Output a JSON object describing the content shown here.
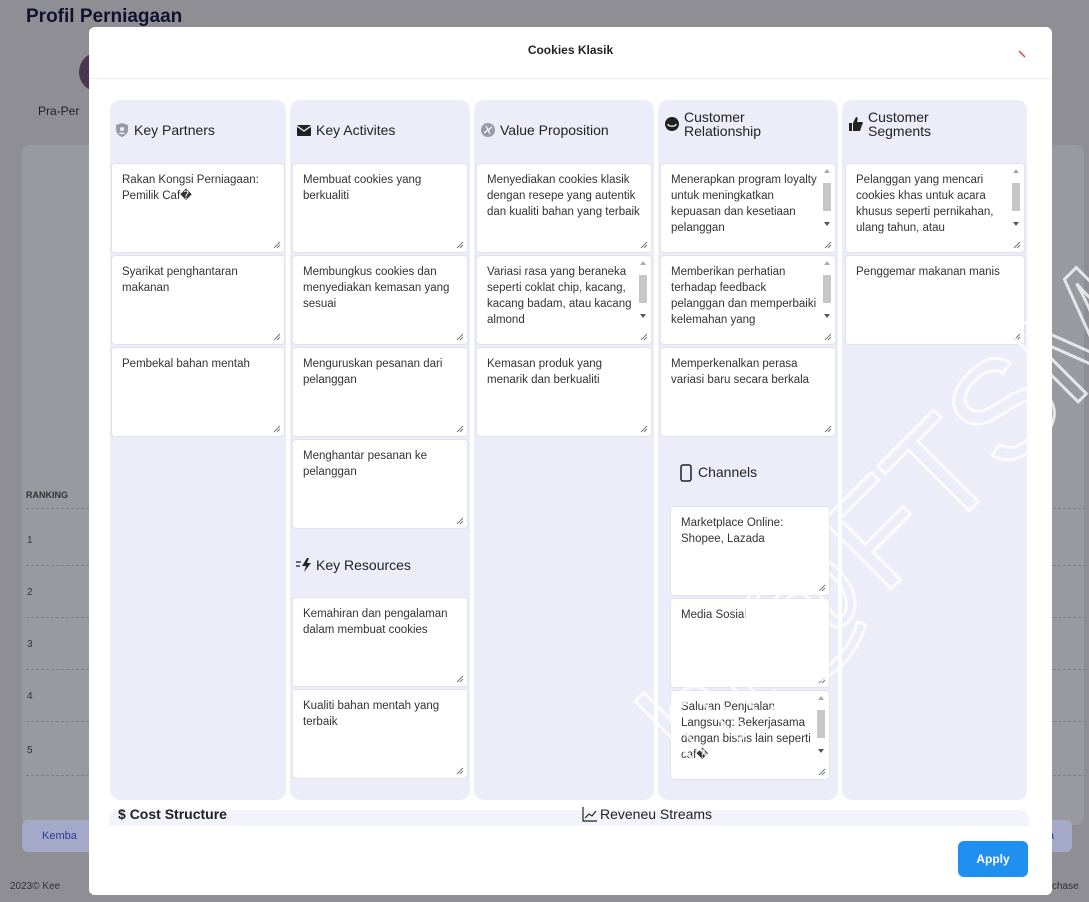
{
  "background": {
    "page_title": "Profil Perniagaan",
    "stage_label": "Pra-Per",
    "ranking_header": "RANKING",
    "ranks": [
      "1",
      "2",
      "3",
      "4",
      "5"
    ],
    "back_button": "Kemba",
    "right_button": "a",
    "footer_left": "2023© Kee",
    "footer_right": "chase"
  },
  "modal": {
    "title": "Cookies Klasik",
    "apply_label": "Apply"
  },
  "canvas": {
    "key_partners": {
      "title": "Key Partners",
      "items": [
        "Rakan Kongsi Perniagaan: Pemilik Caf�",
        "Syarikat penghantaran makanan",
        "Pembekal bahan mentah"
      ]
    },
    "key_activities": {
      "title": "Key Activites",
      "items": [
        "Membuat cookies yang berkualiti",
        "Membungkus cookies dan menyediakan kemasan yang sesuai",
        "Menguruskan pesanan dari pelanggan",
        "Menghantar pesanan ke pelanggan"
      ]
    },
    "key_resources": {
      "title": "Key Resources",
      "items": [
        "Kemahiran dan pengalaman dalam membuat cookies",
        "Kualiti bahan mentah yang terbaik"
      ]
    },
    "value_proposition": {
      "title": "Value Proposition",
      "items": [
        "Menyediakan cookies klasik dengan resepe yang autentik dan kualiti bahan yang terbaik",
        "Variasi rasa yang beraneka seperti coklat chip, kacang, kacang badam, atau kacang almond",
        "Kemasan produk yang menarik dan berkualiti"
      ]
    },
    "customer_relationship": {
      "title_line1": "Customer",
      "title_line2": "Relationship",
      "items": [
        "Menerapkan program loyalty untuk meningkatkan kepuasan dan kesetiaan pelanggan",
        "Memberikan perhatian terhadap feedback pelanggan dan memperbaiki kelemahan yang",
        "Memperkenalkan perasa variasi baru secara berkala"
      ]
    },
    "channels": {
      "title": "Channels",
      "items": [
        "Marketplace Online: Shopee, Lazada",
        "Media Sosial",
        "Saluran Penjualan Langsung: Bekerjasama dengan bisnis lain seperti caf�"
      ]
    },
    "customer_segments": {
      "title_line1": "Customer",
      "title_line2": "Segments",
      "items": [
        "Pelanggan yang mencari cookies khas untuk acara khusus seperti pernikahan, ulang tahun, atau",
        "Penggemar makanan manis"
      ]
    },
    "cost_structure": {
      "title": "Cost Structure"
    },
    "revenue_streams": {
      "title": "Reveneu Streams"
    }
  },
  "watermark_text": "ht@FTSM",
  "colors": {
    "accent": "#1f8ff0",
    "column_bg": "#ededfa",
    "overlay": "#8e8e94"
  }
}
